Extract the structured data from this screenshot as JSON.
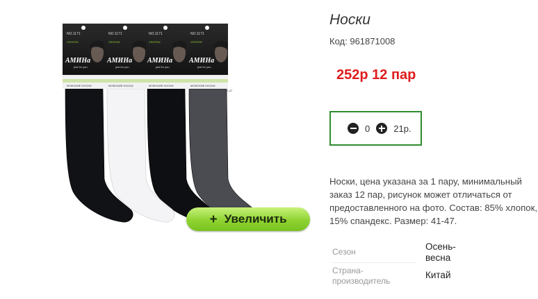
{
  "product": {
    "title": "Носки",
    "code_label": "Код:",
    "code_value": "961871008",
    "price": "252р 12 пар",
    "quantity": "0",
    "unit_price": "21р.",
    "description": "Носки, цена указана за 1 пару, минимальный заказ 12 пар, рисунок может отличаться от предоставленного на фото. Состав: 85% хлопок, 15% спандекс. Размер: 41-47."
  },
  "gallery": {
    "zoom_label": "Увеличить",
    "zoom_icon": "plus-icon",
    "package_no": "NO.1171",
    "package_material": "ХЛОПОК",
    "brand": "АМИНа",
    "tagline": "just for you",
    "package_type": "МУЖСКИЕ НОСКИ",
    "package_size": "41-47",
    "sock_colors": [
      "#111216",
      "#f4f4f6",
      "#0e0f12",
      "#4a4c52"
    ]
  },
  "properties": [
    {
      "label": "Сезон",
      "value": "Осень-\nвесна"
    },
    {
      "label": "Страна-\nпроизводитель",
      "value": "Китай"
    }
  ],
  "colors": {
    "price": "#e01c1c",
    "qty_border": "#2e8b2e",
    "zoom_button": "#8fd332"
  }
}
